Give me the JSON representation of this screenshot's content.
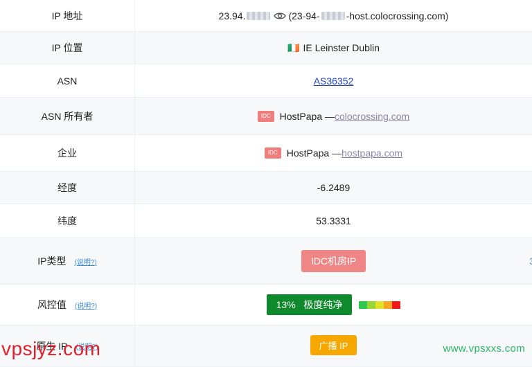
{
  "rows": {
    "ip": {
      "label": "IP 地址",
      "prefix": "23.94.",
      "paren_open": "(23-94-",
      "suffix": "-host.colocrossing.com)",
      "icon": "eye-icon"
    },
    "location": {
      "label": "IP 位置",
      "flag": "🇮🇪",
      "value": "IE Leinster Dublin"
    },
    "asn": {
      "label": "ASN",
      "value": "AS36352"
    },
    "asn_owner": {
      "label": "ASN 所有者",
      "tag": "IDC",
      "name": "HostPapa —",
      "link": "colocrossing.com"
    },
    "company": {
      "label": "企业",
      "tag": "IDC",
      "name": "HostPapa —",
      "link": "hostpapa.com"
    },
    "longitude": {
      "label": "经度",
      "value": "-6.2489"
    },
    "latitude": {
      "label": "纬度",
      "value": "53.3331"
    },
    "ip_type": {
      "label": "IP类型",
      "help": "(说明?)",
      "badge": "IDC机房IP",
      "edge": "3"
    },
    "risk": {
      "label": "风控值",
      "help": "(说明?)",
      "percent": "13%",
      "text": "极度纯净",
      "meter_colors": [
        "#2ec84d",
        "#9ad636",
        "#e3e22a",
        "#f5a623",
        "#f01818"
      ]
    },
    "native": {
      "label": "原生 IP",
      "help": "(说明?)",
      "badge": "广播 IP"
    }
  },
  "watermarks": {
    "left": "vpsjyz.com",
    "right": "www.vpsxxs.com"
  }
}
